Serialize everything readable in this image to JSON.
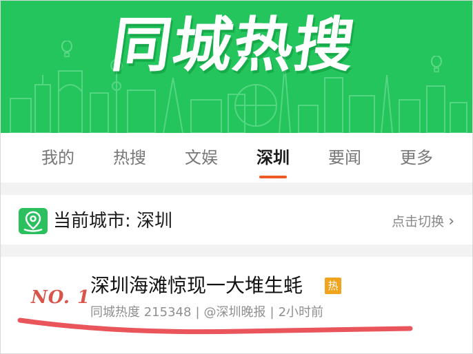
{
  "banner": {
    "title": "同城热搜",
    "color": "#24c55c"
  },
  "tabs": [
    {
      "label": "我的",
      "active": false
    },
    {
      "label": "热搜",
      "active": false
    },
    {
      "label": "文娱",
      "active": false
    },
    {
      "label": "深圳",
      "active": true
    },
    {
      "label": "要闻",
      "active": false
    },
    {
      "label": "更多",
      "active": false
    }
  ],
  "city": {
    "label": "当前城市: 深圳",
    "switch_label": "点击切换",
    "icon": "location-pin-icon"
  },
  "item": {
    "rank": "NO. 1",
    "title": "深圳海滩惊现一大堆生蚝",
    "badge": "热",
    "heat": "同城热度 215348",
    "source": "@深圳晚报",
    "time": "2小时前",
    "separator": "|"
  },
  "colors": {
    "accent": "#ee5a24",
    "badge": "#f0a31c",
    "rank": "#d9554c",
    "pin": "#2bbf5d"
  }
}
